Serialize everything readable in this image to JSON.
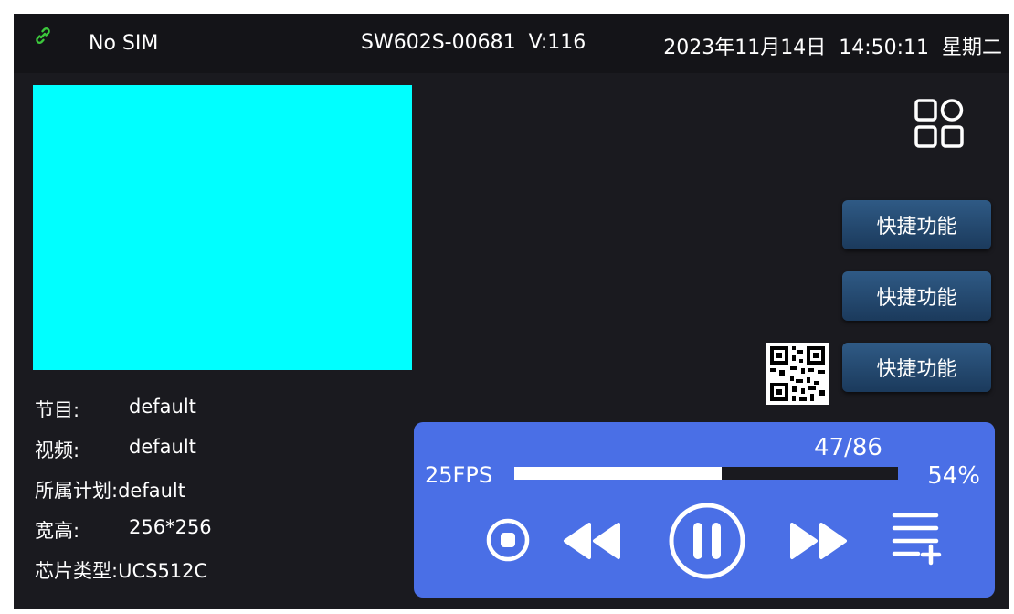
{
  "statusbar": {
    "link_icon": "link-icon",
    "sim": "No SIM",
    "device": "SW602S-00681  V:116",
    "datetime": "2023年11月14日  14:50:11  星期二"
  },
  "program_info": {
    "program_label": "节目:",
    "program_value": "default",
    "video_label": "视频:",
    "video_value": "default",
    "schedule_label": "所属计划:",
    "schedule_value": "default",
    "size_label": "宽高:",
    "size_value": "256*256",
    "chip_label": "芯片类型:",
    "chip_value": "UCS512C"
  },
  "preview_color": "#00ffff",
  "apps_icon": "apps-grid-icon",
  "quick_buttons": [
    "快捷功能",
    "快捷功能",
    "快捷功能"
  ],
  "qr_icon": "qr-code-icon",
  "player": {
    "fps": "25FPS",
    "count": "47/86",
    "percent_label": "54%",
    "progress": 0.54,
    "controls": [
      "stop-icon",
      "rewind-icon",
      "pause-icon",
      "fast-forward-icon",
      "playlist-add-icon"
    ]
  },
  "colors": {
    "background": "#1a1a1f",
    "player_panel": "#4a6fe6",
    "button": "#22466b",
    "link_icon": "#3cc83c"
  }
}
